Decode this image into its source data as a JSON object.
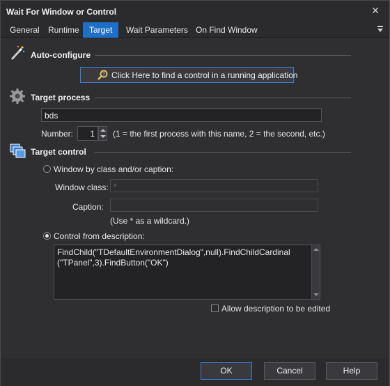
{
  "window": {
    "title": "Wait For Window or Control"
  },
  "tabs": [
    {
      "label": "General"
    },
    {
      "label": "Runtime"
    },
    {
      "label": "Target"
    },
    {
      "label": "Wait Parameters"
    },
    {
      "label": "On Find Window"
    }
  ],
  "autoconfigure": {
    "heading": "Auto-configure",
    "button_label": "Click Here to find a control in a running application"
  },
  "target_process": {
    "heading": "Target process",
    "process_value": "bds",
    "number_label": "Number:",
    "number_value": "1",
    "number_hint": "(1 = the first process with this name, 2 = the second, etc.)"
  },
  "target_control": {
    "heading": "Target control",
    "radio_window_label": "Window by class and/or caption:",
    "window_class_label": "Window class:",
    "window_class_value": "*",
    "caption_label": "Caption:",
    "caption_value": "",
    "wildcard_hint": "(Use * as a wildcard.)",
    "radio_description_label": "Control from description:",
    "description_value": "FindChild(\"TDefaultEnvironmentDialog\",null).FindChildCardinal\n(\"TPanel\",3).FindButton(\"OK\")",
    "allow_edit_label": "Allow description to be edited"
  },
  "footer": {
    "ok_label": "OK",
    "cancel_label": "Cancel",
    "help_label": "Help"
  },
  "colors": {
    "accent": "#1e6fc9",
    "background": "#2f2f32"
  }
}
